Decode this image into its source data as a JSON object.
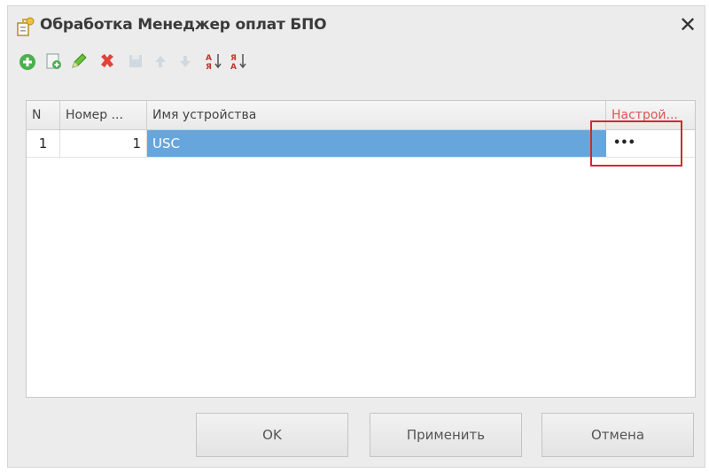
{
  "window": {
    "title": "Обработка  Менеджер оплат БПО",
    "close_glyph": "✕"
  },
  "toolbar": {
    "buttons": [
      {
        "icon": "add-icon"
      },
      {
        "icon": "copy-icon"
      },
      {
        "icon": "edit-icon"
      },
      {
        "icon": "delete-icon"
      },
      {
        "icon": "save-icon"
      },
      {
        "icon": "move-up-icon"
      },
      {
        "icon": "move-down-icon"
      },
      {
        "icon": "sort-ascending-icon"
      },
      {
        "icon": "sort-descending-icon"
      }
    ]
  },
  "table": {
    "columns": [
      "N",
      "Номер ...",
      "Имя устройства",
      "Настрой..."
    ],
    "rows": [
      {
        "n": "1",
        "number": "1",
        "device": "USC",
        "settings": "•••"
      }
    ]
  },
  "buttons": {
    "ok": "OK",
    "apply": "Применить",
    "cancel": "Отмена"
  },
  "colors": {
    "selection": "#67a6dc",
    "highlight": "#d22a2a",
    "delete_icon": "#e0433a",
    "add_icon": "#4caf50"
  }
}
